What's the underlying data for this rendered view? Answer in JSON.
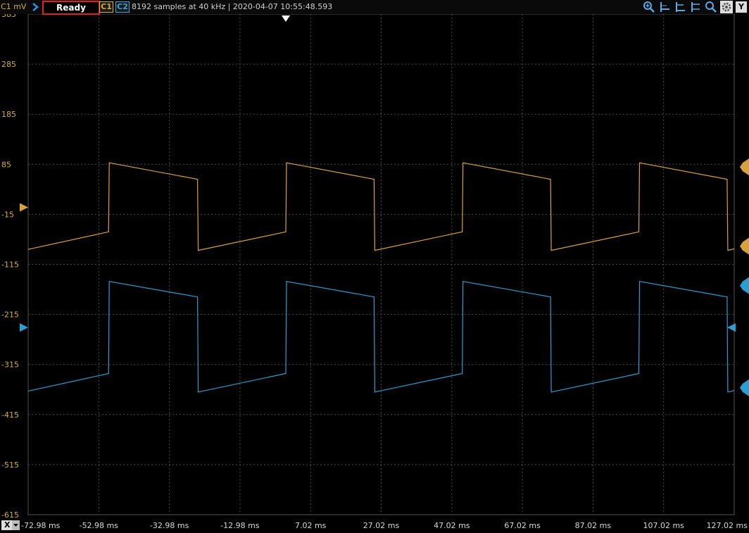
{
  "toolbar": {
    "channel_unit": "C1 mV",
    "status": "Ready",
    "channel1": "C1",
    "channel2": "C2",
    "info": "8192 samples at 40 kHz | 2020-04-07 10:55:48.593",
    "icons": [
      "zoom-in-icon",
      "cursor-horizontal-icon",
      "cursor-vertical-icon",
      "cursor-pair-icon",
      "zoom-fit-icon",
      "settings-icon"
    ],
    "y_button": "Y"
  },
  "x_axis": {
    "dropdown_label": "X",
    "ticks": [
      "-72.98 ms",
      "-52.98 ms",
      "-32.98 ms",
      "-12.98 ms",
      "7.02 ms",
      "27.02 ms",
      "47.02 ms",
      "67.02 ms",
      "87.02 ms",
      "107.02 ms",
      "127.02 ms"
    ]
  },
  "y_axis": {
    "ticks": [
      "385",
      "285",
      "185",
      "85",
      "-15",
      "-115",
      "-215",
      "-315",
      "-415",
      "-515",
      "-615"
    ]
  },
  "chart_data": {
    "type": "line",
    "title": "",
    "xlabel": "",
    "ylabel": "",
    "xlim": [
      -72.98,
      127.02
    ],
    "ylim": [
      -615,
      385
    ],
    "x_unit": "ms",
    "y_unit": "mV",
    "grid": true,
    "series": [
      {
        "color": "#d8a33c",
        "x": [
          -72.98,
          -50.2,
          -50.0,
          -25.0,
          -24.8,
          0.0,
          0.2,
          25.0,
          25.2,
          50.0,
          50.2,
          75.0,
          75.2,
          100.0,
          100.2,
          125.0,
          125.2,
          127.02
        ],
        "y": [
          -85,
          -50,
          88,
          55,
          -87,
          -50,
          88,
          55,
          -87,
          -50,
          88,
          55,
          -87,
          -50,
          88,
          55,
          -87,
          -84
        ]
      },
      {
        "color": "#2c9fd2",
        "x": [
          -72.98,
          -50.2,
          -50.0,
          -25.0,
          -24.8,
          0.0,
          0.2,
          25.0,
          25.2,
          50.0,
          50.2,
          75.0,
          75.2,
          100.0,
          100.2,
          125.0,
          125.2,
          127.02
        ],
        "y": [
          -368,
          -333,
          -149,
          -180,
          -370,
          -333,
          -149,
          -180,
          -370,
          -333,
          -149,
          -180,
          -370,
          -333,
          -149,
          -180,
          -370,
          -367
        ]
      }
    ],
    "markers": {
      "c1_offset": -1,
      "c2_offset": -241,
      "trigger_time": 0.0
    }
  }
}
